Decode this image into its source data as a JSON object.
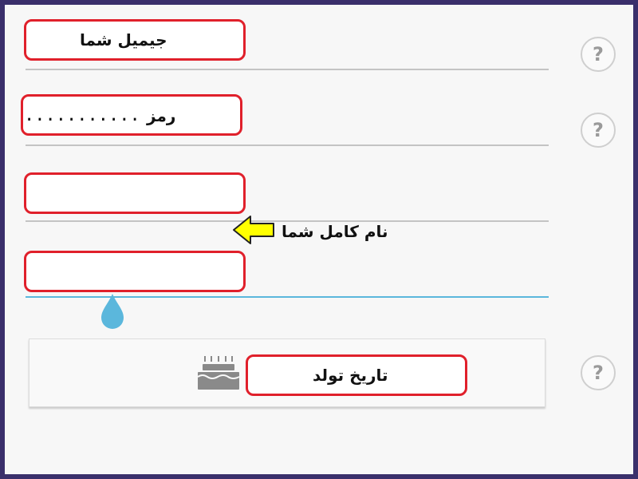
{
  "form": {
    "email_label": "جیمیل شما",
    "password_label": "رمز",
    "password_value": "...........",
    "fullname_label": "نام کامل شما",
    "birthdate_label": "تاریخ تولد",
    "help_symbol": "?"
  },
  "icons": {
    "help": "question-mark-circle-icon",
    "cake": "birthday-cake-icon",
    "arrow": "arrow-left-icon",
    "cursor": "text-cursor-handle-icon"
  },
  "colors": {
    "frame": "#3a2f6b",
    "highlight_border": "#e0202b",
    "arrow_fill": "#ffff00",
    "active_underline": "#5bb7dc"
  }
}
